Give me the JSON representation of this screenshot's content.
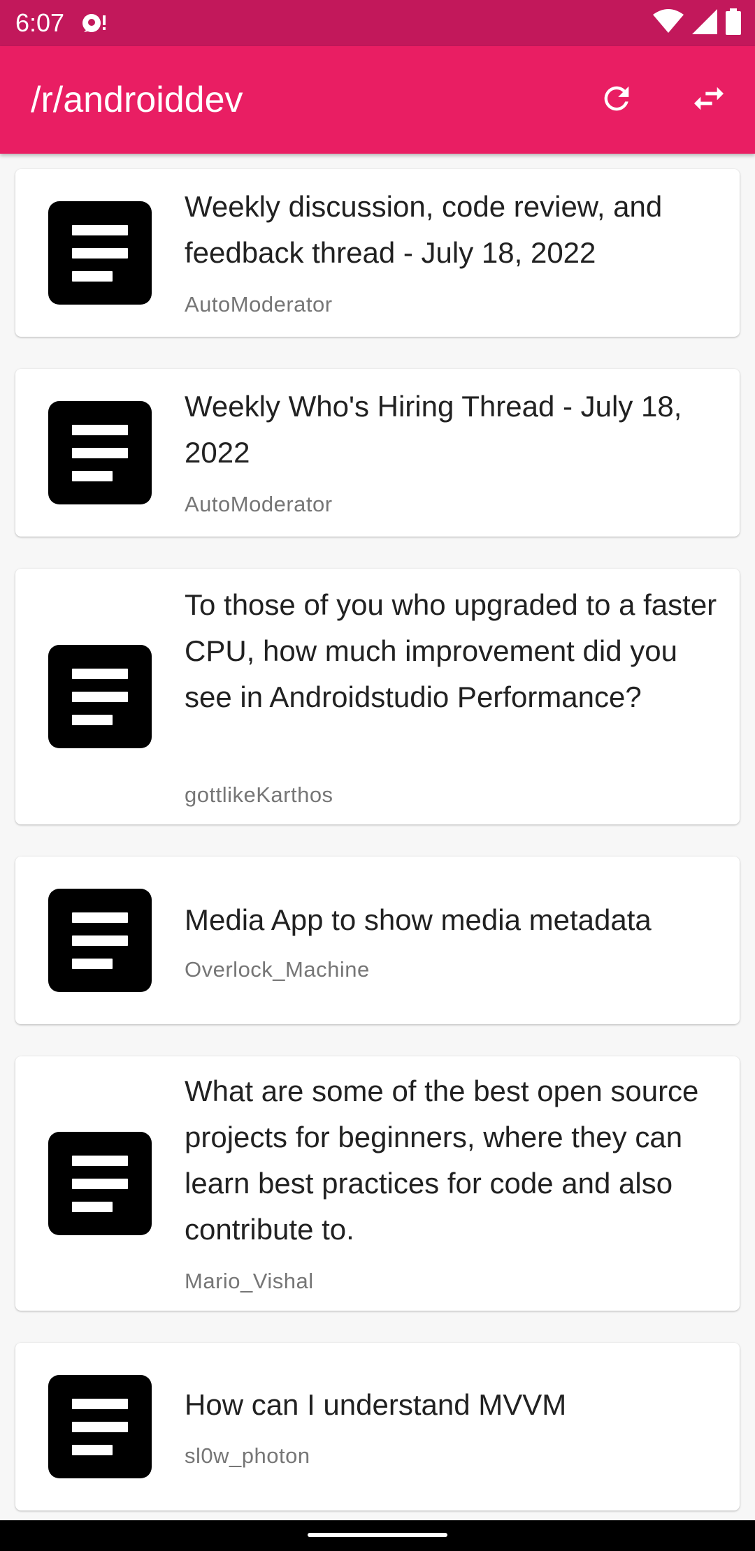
{
  "status_bar": {
    "time": "6:07",
    "icons": [
      "notification-icon",
      "wifi-icon",
      "signal-icon",
      "battery-icon"
    ]
  },
  "app_bar": {
    "title": "/r/androiddev",
    "actions": [
      "refresh-icon",
      "swap-icon"
    ]
  },
  "posts": [
    {
      "title": "Weekly discussion, code review, and feedback thread - July 18, 2022",
      "author": "AutoModerator"
    },
    {
      "title": "Weekly Who's Hiring Thread - July 18, 2022",
      "author": "AutoModerator"
    },
    {
      "title": "To those of you who upgraded to a faster CPU, how much improvement did you see in Androidstudio Performance?",
      "author": "gottlikeKarthos"
    },
    {
      "title": "Media App to show media metadata",
      "author": "Overlock_Machine"
    },
    {
      "title": "What are some of the best open source projects for beginners, where they can learn best practices for code and also contribute to.",
      "author": "Mario_Vishal"
    },
    {
      "title": "How can I understand MVVM",
      "author": "sl0w_photon"
    }
  ],
  "colors": {
    "status_bar": "#c2185b",
    "app_bar": "#e91e63",
    "background": "#f7f7f7",
    "card": "#ffffff",
    "title_text": "#212121",
    "author_text": "#767676"
  }
}
